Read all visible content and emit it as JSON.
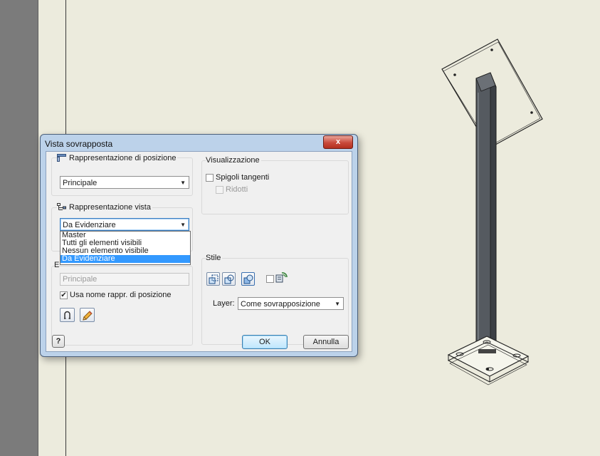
{
  "dialog": {
    "title": "Vista sovrapposta",
    "close_label": "x",
    "posizione": {
      "group_label": "Rappresentazione di posizione",
      "selected": "Principale"
    },
    "vista": {
      "group_label": "Rappresentazione vista",
      "selected": "Da Evidenziare",
      "options": [
        "Master",
        "Tutti gli elementi visibili",
        "Nessun elemento visibile",
        "Da Evidenziare"
      ]
    },
    "etichetta": {
      "group_label_partial": "E",
      "name_value": "Principale",
      "use_name_label": "Usa nome rappr. di posizione",
      "use_name_checked": true
    },
    "visualizzazione": {
      "group_label": "Visualizzazione",
      "tangent_label": "Spigoli tangenti",
      "tangent_checked": false,
      "reduced_label": "Ridotti",
      "reduced_checked": false
    },
    "stile": {
      "group_label": "Stile",
      "layer_label": "Layer:",
      "layer_value": "Come sovrapposizione"
    },
    "help_label": "?",
    "ok_label": "OK",
    "cancel_label": "Annulla"
  }
}
